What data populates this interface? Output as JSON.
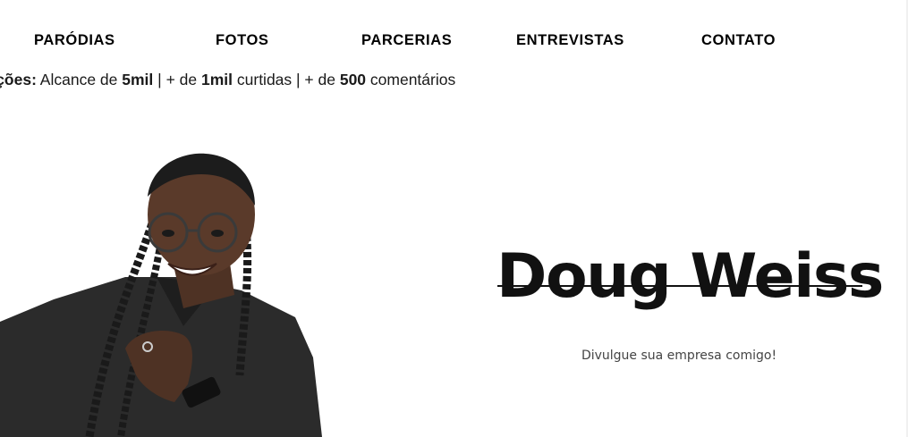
{
  "nav": {
    "items": [
      {
        "label": "PARÓDIAS"
      },
      {
        "label": "FOTOS"
      },
      {
        "label": "PARCERIAS"
      },
      {
        "label": "ENTREVISTAS"
      },
      {
        "label": "CONTATO"
      }
    ]
  },
  "ticker": {
    "lead": "licações:",
    "t1": " Alcance de ",
    "b1": "5mil",
    "t2": " | + de ",
    "b2": "1mil",
    "t3": " curtidas | + de ",
    "b3": "500",
    "t4": " comentários"
  },
  "hero": {
    "title": "Doug Weiss",
    "subtitle": "Divulgue sua empresa comigo!"
  },
  "colors": {
    "text": "#111111",
    "shirt": "#2a2a2a",
    "skin": "#5a3a2a"
  }
}
